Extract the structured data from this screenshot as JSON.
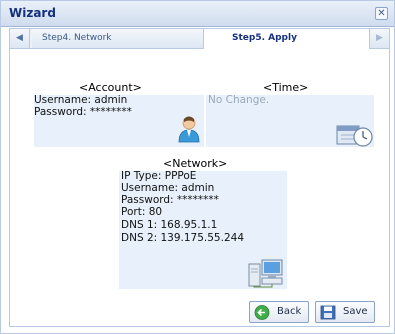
{
  "window": {
    "title": "Wizard",
    "close_glyph": "✕"
  },
  "tabs": [
    {
      "label": "Step4. Network",
      "active": false
    },
    {
      "label": "Step5. Apply",
      "active": true
    }
  ],
  "tab_scroll": {
    "left_glyph": "◀",
    "right_glyph": "▶"
  },
  "account": {
    "heading": "<Account>",
    "username": "Username: admin",
    "password": "Password: ********",
    "icon": "user-icon"
  },
  "time": {
    "heading": "<Time>",
    "status": "No Change.",
    "icon": "calendar-clock-icon"
  },
  "network": {
    "heading": "<Network>",
    "lines": [
      "IP Type: PPPoE",
      "Username: admin",
      "Password: ********",
      "Port: 80",
      "DNS 1: 168.95.1.1",
      "DNS 2: 139.175.55.244"
    ],
    "icon": "network-computers-icon"
  },
  "buttons": {
    "back_label": "Back",
    "back_icon": "back-arrow-icon",
    "save_label": "Save",
    "save_icon": "floppy-disk-icon"
  },
  "colors": {
    "title_text": "#15317e",
    "panel_fill": "#e8f1fb",
    "border": "#b7c9e3",
    "muted_text": "#9aa8b8"
  }
}
